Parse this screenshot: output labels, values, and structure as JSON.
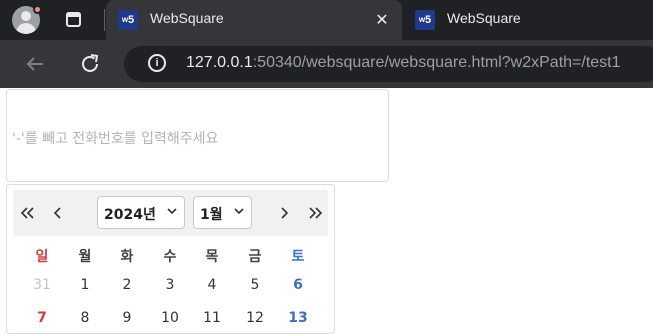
{
  "browser": {
    "tabs": [
      {
        "title": "WebSquare",
        "favicon": "w5"
      },
      {
        "title": "WebSquare",
        "favicon": "w5"
      }
    ],
    "close_symbol": "✕",
    "url_host": "127.0.0.1",
    "url_rest": ":50340/websquare/websquare.html?w2xPath=/test1"
  },
  "form": {
    "phone_placeholder": "'-'를 빼고 전화번호를 입력해주세요"
  },
  "calendar": {
    "year_label": "2024년",
    "month_label": "1월",
    "weekdays": [
      "일",
      "월",
      "화",
      "수",
      "목",
      "금",
      "토"
    ],
    "weeks": [
      [
        "31",
        "1",
        "2",
        "3",
        "4",
        "5",
        "6"
      ],
      [
        "7",
        "8",
        "9",
        "10",
        "11",
        "12",
        "13"
      ]
    ],
    "colors": {
      "sunday": "#d93a3a",
      "saturday": "#3f6ec6",
      "other_month": "#c4c4c4"
    }
  }
}
